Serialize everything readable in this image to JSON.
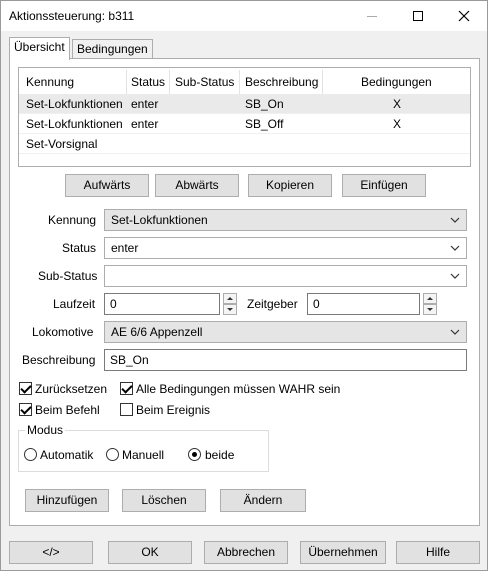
{
  "window": {
    "title": "Aktionssteuerung: b311"
  },
  "tabs": [
    {
      "label": "Übersicht"
    },
    {
      "label": "Bedingungen"
    }
  ],
  "list": {
    "columns": [
      "Kennung",
      "Status",
      "Sub-Status",
      "Beschreibung",
      "Bedingungen"
    ],
    "rows": [
      {
        "kennung": "Set-Lokfunktionen",
        "status": "enter",
        "substatus": "",
        "beschreibung": "SB_On",
        "bedingungen": "X"
      },
      {
        "kennung": "Set-Lokfunktionen",
        "status": "enter",
        "substatus": "",
        "beschreibung": "SB_Off",
        "bedingungen": "X"
      },
      {
        "kennung": "Set-Vorsignal",
        "status": "",
        "substatus": "",
        "beschreibung": "",
        "bedingungen": ""
      }
    ]
  },
  "listbuttons": {
    "up": "Aufwärts",
    "down": "Abwärts",
    "copy": "Kopieren",
    "paste": "Einfügen"
  },
  "form": {
    "kennung_label": "Kennung",
    "kennung_value": "Set-Lokfunktionen",
    "status_label": "Status",
    "status_value": "enter",
    "substatus_label": "Sub-Status",
    "substatus_value": "",
    "laufzeit_label": "Laufzeit",
    "laufzeit_value": "0",
    "zeitgeber_label": "Zeitgeber",
    "zeitgeber_value": "0",
    "lok_label": "Lokomotive",
    "lok_value": "AE 6/6 Appenzell",
    "beschreibung_label": "Beschreibung",
    "beschreibung_value": "SB_On"
  },
  "checks": {
    "reset": "Zurücksetzen",
    "all_true": "Alle Bedingungen müssen WAHR sein",
    "on_command": "Beim Befehl",
    "on_event": "Beim Ereignis"
  },
  "modus": {
    "label": "Modus",
    "auto": "Automatik",
    "manual": "Manuell",
    "both": "beide"
  },
  "actions": {
    "add": "Hinzufügen",
    "delete": "Löschen",
    "change": "Ändern"
  },
  "footer": {
    "code": "</>",
    "ok": "OK",
    "cancel": "Abbrechen",
    "apply": "Übernehmen",
    "help": "Hilfe"
  }
}
